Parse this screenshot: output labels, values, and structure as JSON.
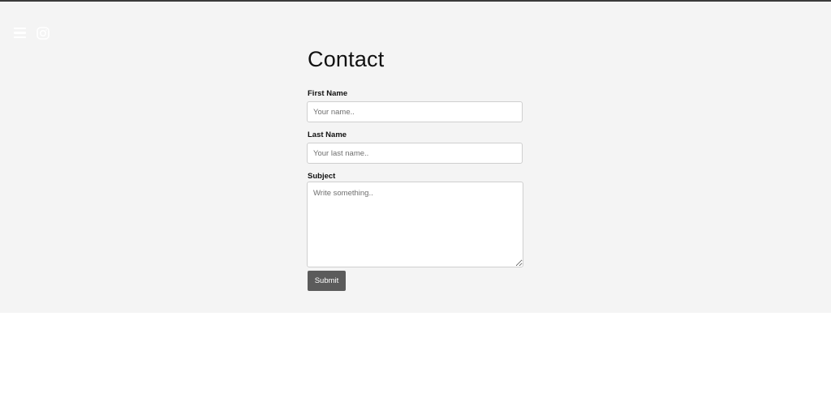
{
  "header": {
    "menu_icon": "hamburger-menu-icon",
    "social_icon": "instagram-icon",
    "icon_color": "#ffffff"
  },
  "contact": {
    "title": "Contact",
    "first_name": {
      "label": "First Name",
      "placeholder": "Your name.."
    },
    "last_name": {
      "label": "Last Name",
      "placeholder": "Your last name.."
    },
    "subject": {
      "label": "Subject",
      "placeholder": "Write something.."
    },
    "submit_label": "Submit"
  },
  "colors": {
    "band_background": "#f4f4f4",
    "button_background": "#5b5b5b",
    "top_border": "#3a3a3a"
  }
}
